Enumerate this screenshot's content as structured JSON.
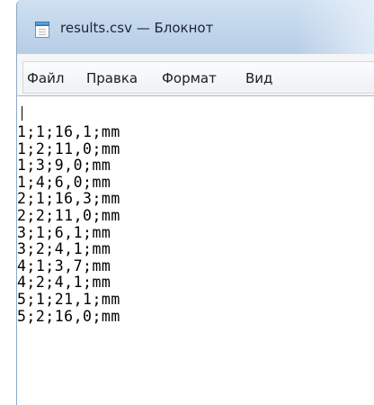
{
  "window": {
    "title": "results.csv — Блокнот",
    "icon": "notepad-icon"
  },
  "menu": {
    "items": [
      "Файл",
      "Правка",
      "Формат",
      "Вид"
    ]
  },
  "editor": {
    "lines": [
      "1;1;16,1;mm",
      "1;2;11,0;mm",
      "1;3;9,0;mm",
      "1;4;6,0;mm",
      "2;1;16,3;mm",
      "2;2;11,0;mm",
      "3;1;6,1;mm",
      "3;2;4,1;mm",
      "4;1;3,7;mm",
      "4;2;4,1;mm",
      "5;1;21,1;mm",
      "5;2;16,0;mm"
    ]
  }
}
